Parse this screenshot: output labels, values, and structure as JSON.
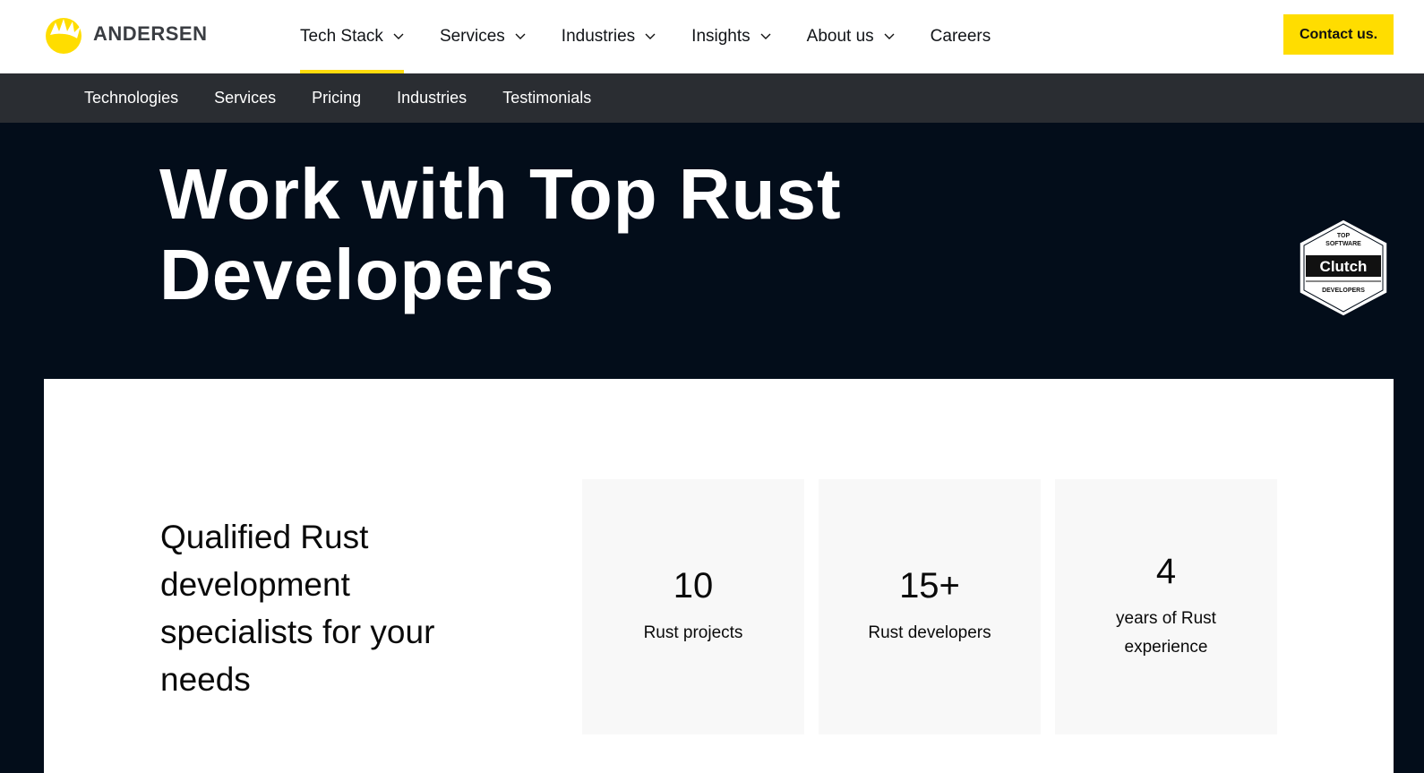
{
  "header": {
    "logo_text": "ANDERSEN",
    "nav": [
      {
        "label": "Tech Stack",
        "icon": "chevron-down-icon"
      },
      {
        "label": "Services",
        "icon": "chevron-down-icon"
      },
      {
        "label": "Industries",
        "icon": "chevron-down-icon"
      },
      {
        "label": "Insights",
        "icon": "chevron-down-icon"
      },
      {
        "label": "About us",
        "icon": "chevron-down-icon"
      },
      {
        "label": "Careers"
      }
    ],
    "active_nav": "Tech Stack",
    "contact_label": "Contact us."
  },
  "subnav": [
    "Technologies",
    "Services",
    "Pricing",
    "Industries",
    "Testimonials"
  ],
  "hero": {
    "title_line1": "Work with Top Rust",
    "title_line2": "Developers",
    "badge": {
      "top": "TOP",
      "middle": "SOFTWARE",
      "brand": "Clutch",
      "bottom": "DEVELOPERS"
    }
  },
  "stats_section": {
    "heading": "Qualified Rust development specialists for your needs",
    "stats": [
      {
        "value": "10",
        "label": "Rust projects"
      },
      {
        "value": "15+",
        "label": "Rust developers"
      },
      {
        "value": "4",
        "label": "years of Rust experience"
      }
    ]
  },
  "colors": {
    "accent": "#ffdd00",
    "hero_bg": "#030d1a",
    "subnav_bg": "#2a2d32"
  }
}
